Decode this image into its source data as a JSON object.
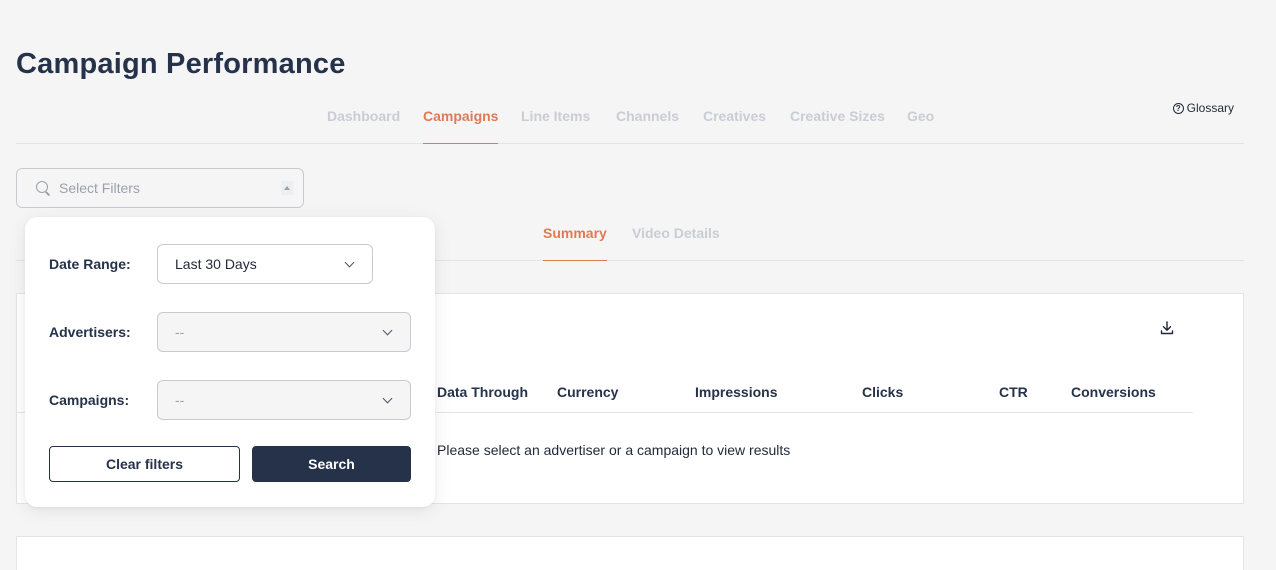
{
  "page": {
    "title": "Campaign Performance"
  },
  "nav": {
    "tabs": [
      {
        "label": "Dashboard"
      },
      {
        "label": "Campaigns"
      },
      {
        "label": "Line Items"
      },
      {
        "label": "Channels"
      },
      {
        "label": "Creatives"
      },
      {
        "label": "Creative Sizes"
      },
      {
        "label": "Geo"
      }
    ],
    "active_tab": "Campaigns",
    "glossary": {
      "icon": "question-circle-icon",
      "label": "Glossary"
    }
  },
  "filters": {
    "select": {
      "placeholder": "Select Filters",
      "icon": "search-icon"
    },
    "popover": {
      "date_range": {
        "label": "Date Range:",
        "value": "Last 30 Days"
      },
      "advertisers": {
        "label": "Advertisers:",
        "value": "--"
      },
      "campaigns": {
        "label": "Campaigns:",
        "value": "--"
      },
      "clear_label": "Clear filters",
      "search_label": "Search"
    }
  },
  "subtabs": {
    "tabs": [
      {
        "label": "Summary"
      },
      {
        "label": "Video Details"
      }
    ],
    "active_tab": "Summary"
  },
  "table": {
    "download_icon": "download-icon",
    "visible_columns": [
      "Data Through",
      "Currency",
      "Impressions",
      "Clicks",
      "CTR",
      "Conversions"
    ],
    "empty_message": "Please select an advertiser or a campaign to view results"
  },
  "colors": {
    "accent": "#e07a55",
    "primary_dark": "#25324a",
    "muted_tab": "#c9cdd4",
    "background": "#f5f5f6"
  }
}
